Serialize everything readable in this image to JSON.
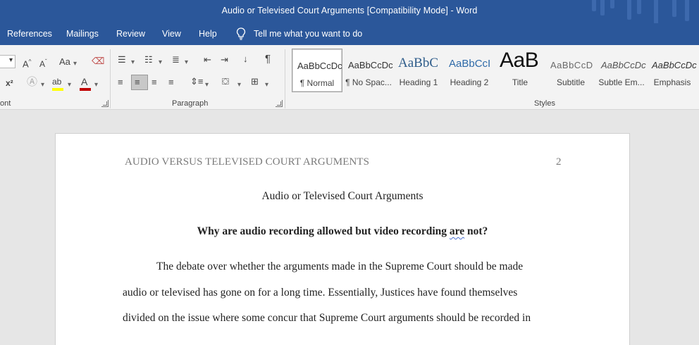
{
  "window": {
    "title": "Audio or Televised Court Arguments [Compatibility Mode]  -  Word"
  },
  "menu": {
    "tabs": [
      "References",
      "Mailings",
      "Review",
      "View",
      "Help"
    ],
    "tell_me": "Tell me what you want to do"
  },
  "ribbon": {
    "font_group_label": "ont",
    "paragraph_group_label": "Paragraph",
    "styles_group_label": "Styles",
    "styles": [
      {
        "sample": "AaBbCcDc",
        "label": "¶ Normal"
      },
      {
        "sample": "AaBbCcDc",
        "label": "¶ No Spac..."
      },
      {
        "sample": "AaBbC",
        "label": "Heading 1"
      },
      {
        "sample": "AaBbCcI",
        "label": "Heading 2"
      },
      {
        "sample": "AaB",
        "label": "Title"
      },
      {
        "sample": "AaBbCcD",
        "label": "Subtitle"
      },
      {
        "sample": "AaBbCcDc",
        "label": "Subtle Em..."
      },
      {
        "sample": "AaBbCcDc",
        "label": "Emphasis"
      }
    ],
    "colors": {
      "highlight": "#ffff00",
      "font_color": "#c00000"
    }
  },
  "document": {
    "running_head": "AUDIO VERSUS TELEVISED COURT ARGUMENTS",
    "page_number": "2",
    "title": "Audio or Televised Court Arguments",
    "question_before": "Why are audio recording allowed but video recording ",
    "question_flagged": "are",
    "question_after": " not?",
    "lines": [
      "The debate over whether the arguments made in the Supreme Court should be made",
      "audio or televised has gone on for a long time. Essentially, Justices have found themselves",
      "divided on the issue where some concur that Supreme Court arguments should be recorded in"
    ]
  }
}
